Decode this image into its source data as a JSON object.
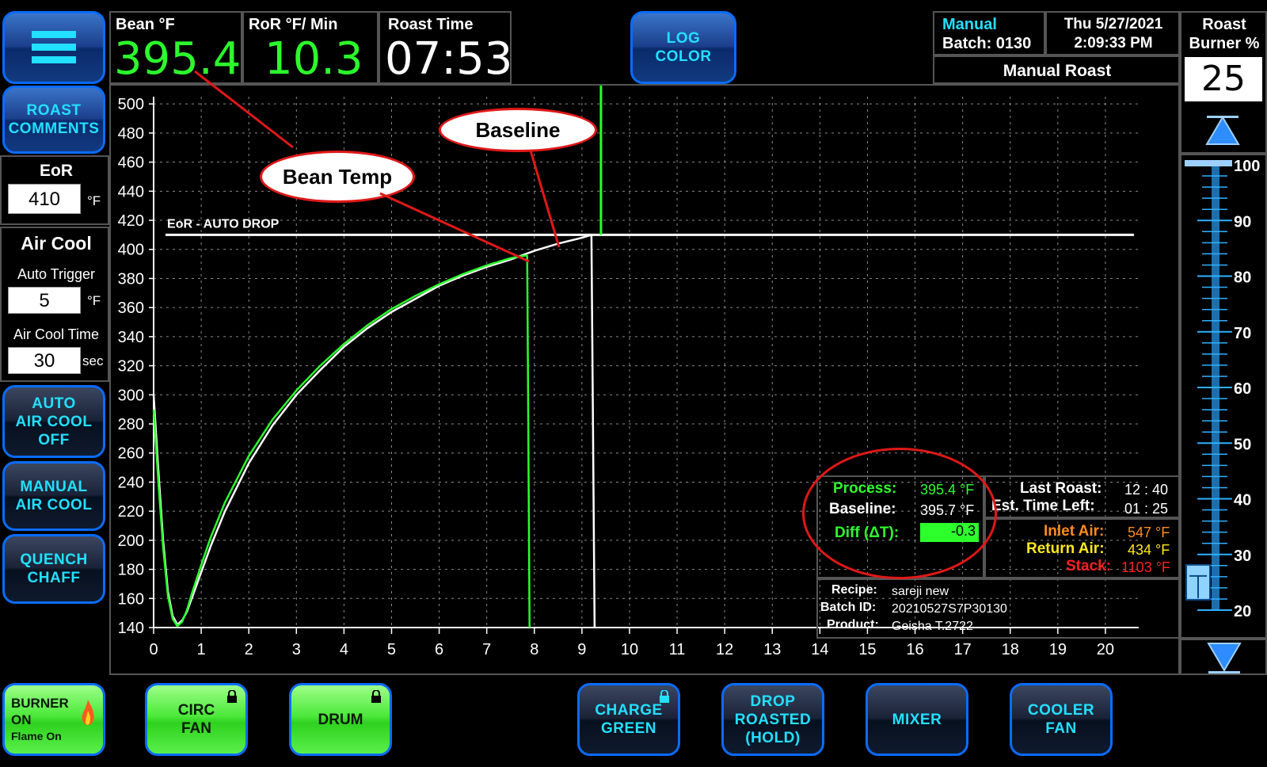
{
  "header": {
    "bean_label": "Bean °F",
    "bean_value": "395.4",
    "ror_label": "RoR °F/ Min",
    "ror_value": "10.3",
    "roast_time_label": "Roast Time",
    "roast_time_value": "07:53",
    "log_color_line1": "LOG",
    "log_color_line2": "COLOR",
    "mode": "Manual",
    "batch": "Batch: 0130",
    "date": "Thu 5/27/2021",
    "time": "2:09:33 PM",
    "roast_name": "Manual Roast",
    "burner_label_line1": "Roast",
    "burner_label_line2": "Burner %",
    "burner_value": "25"
  },
  "left": {
    "roast_comments_line1": "ROAST",
    "roast_comments_line2": "COMMENTS",
    "eor_label": "EoR",
    "eor_value": "410",
    "eor_unit": "°F",
    "air_cool_label": "Air Cool",
    "auto_trigger_label": "Auto Trigger",
    "auto_trigger_value": "5",
    "auto_trigger_unit": "°F",
    "air_cool_time_label": "Air Cool Time",
    "air_cool_time_value": "30",
    "air_cool_time_unit": "sec",
    "auto_air_cool_line1": "AUTO",
    "auto_air_cool_line2": "AIR COOL",
    "auto_air_cool_line3": "OFF",
    "manual_air_cool_line1": "MANUAL",
    "manual_air_cool_line2": "AIR COOL",
    "quench_line1": "QUENCH",
    "quench_line2": "CHAFF"
  },
  "bottom": {
    "burner_line1": "BURNER",
    "burner_line2": "ON",
    "burner_line3": "Flame On",
    "circ_line1": "CIRC",
    "circ_line2": "FAN",
    "drum": "DRUM",
    "charge_line1": "CHARGE",
    "charge_line2": "GREEN",
    "drop_line1": "DROP",
    "drop_line2": "ROASTED",
    "drop_line3": "(HOLD)",
    "mixer": "MIXER",
    "cooler_line1": "COOLER",
    "cooler_line2": "FAN"
  },
  "annotations": {
    "bean_temp": "Bean Temp",
    "baseline": "Baseline",
    "eor_line": "EoR  - AUTO DROP"
  },
  "stats": {
    "process_label": "Process:",
    "process_value": "395.4 °F",
    "baseline_label": "Baseline:",
    "baseline_value": "395.7 °F",
    "diff_label": "Diff (ΔT):",
    "diff_value": "-0.3",
    "last_roast_label": "Last Roast:",
    "last_roast_value": "12 : 40",
    "est_time_label": "Est. Time Left:",
    "est_time_value": "01 : 25",
    "inlet_label": "Inlet Air:",
    "inlet_value": "547 °F",
    "return_label": "Return Air:",
    "return_value": "434 °F",
    "stack_label": "Stack:",
    "stack_value": "1103 °F",
    "recipe_label": "Recipe:",
    "recipe_value": "sareji new",
    "batchid_label": "Batch ID:",
    "batchid_value": "20210527S7P30130",
    "product_label": "Product:",
    "product_value": "Geisha T.2722"
  },
  "colors": {
    "green": "#2cff2c",
    "cyan": "#22e0ff",
    "orange": "#ff8c1a",
    "yellow": "#ffe81a",
    "red": "#ff2020"
  },
  "burner_slider": {
    "ticks": [
      "100",
      "90",
      "80",
      "70",
      "60",
      "50",
      "40",
      "30",
      "20"
    ],
    "min": 20,
    "max": 100,
    "value": 25
  },
  "chart_data": {
    "type": "line",
    "x_ticks": [
      "0",
      "1",
      "2",
      "3",
      "4",
      "5",
      "6",
      "7",
      "8",
      "9",
      "10",
      "11",
      "12",
      "13",
      "14",
      "15",
      "16",
      "17",
      "18",
      "19",
      "20"
    ],
    "y_ticks": [
      "500",
      "480",
      "460",
      "440",
      "420",
      "400",
      "380",
      "360",
      "340",
      "320",
      "300",
      "280",
      "260",
      "240",
      "220",
      "200",
      "180",
      "160",
      "140"
    ],
    "xlim": [
      0,
      20.7
    ],
    "ylim": [
      140,
      505
    ],
    "eor_value": 410,
    "eor_xrange": [
      0.25,
      20.6
    ],
    "baseline_drop_x": 9.4,
    "current_drop_x": 7.85,
    "series": [
      {
        "color": "#2cff2c",
        "x": [
          0,
          0.1,
          0.2,
          0.3,
          0.4,
          0.5,
          0.6,
          0.7,
          0.8,
          1.0,
          1.2,
          1.5,
          2.0,
          2.5,
          3.0,
          3.5,
          4.0,
          4.5,
          5.0,
          5.5,
          6.0,
          6.5,
          7.0,
          7.5,
          7.85
        ],
        "y": [
          290,
          240,
          195,
          162,
          146,
          141,
          144,
          152,
          163,
          183,
          202,
          226,
          258,
          283,
          303,
          320,
          335,
          348,
          359,
          368,
          376,
          383,
          389,
          394,
          396
        ]
      },
      {
        "color": "#ffffff",
        "x": [
          0,
          0.1,
          0.2,
          0.3,
          0.4,
          0.5,
          0.6,
          0.7,
          0.8,
          1.0,
          1.2,
          1.5,
          2.0,
          2.5,
          3.0,
          3.5,
          4.0,
          4.5,
          5.0,
          5.5,
          6.0,
          6.5,
          7.0,
          7.5,
          8.0,
          8.5,
          9.0,
          9.2
        ],
        "y": [
          300,
          248,
          200,
          165,
          148,
          142,
          145,
          151,
          160,
          178,
          196,
          220,
          253,
          279,
          300,
          317,
          333,
          346,
          357,
          366,
          375,
          382,
          388,
          393,
          399,
          404,
          408,
          410
        ]
      }
    ]
  }
}
